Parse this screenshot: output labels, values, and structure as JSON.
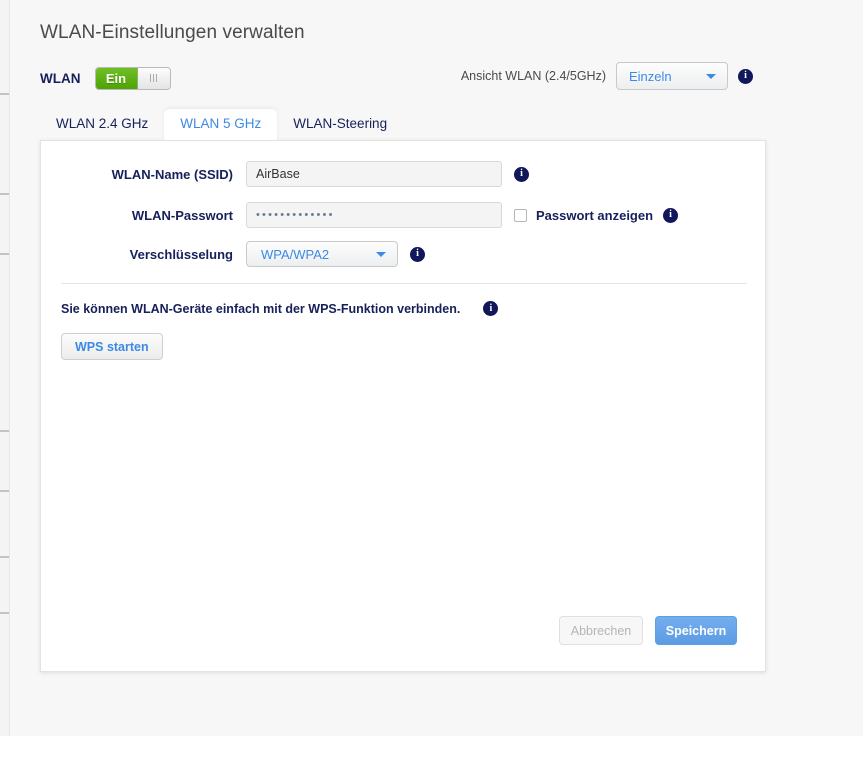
{
  "page": {
    "title": "WLAN-Einstellungen verwalten"
  },
  "header": {
    "wlan_label": "WLAN",
    "toggle_state_label": "Ein",
    "view_label": "Ansicht WLAN (2.4/5GHz)",
    "view_value": "Einzeln",
    "view_options": [
      "Einzeln"
    ],
    "info_icon": "info-icon"
  },
  "tabs": [
    {
      "label": "WLAN 2.4 GHz",
      "active": false
    },
    {
      "label": "WLAN 5 GHz",
      "active": true
    },
    {
      "label": "WLAN-Steering",
      "active": false
    }
  ],
  "form": {
    "ssid": {
      "label": "WLAN-Name (SSID)",
      "value": "AirBase",
      "placeholder": ""
    },
    "password": {
      "label": "WLAN-Passwort",
      "value": "•••••••••••••",
      "placeholder": "",
      "show_password_label": "Passwort anzeigen",
      "show_password_checked": false
    },
    "encryption": {
      "label": "Verschlüsselung",
      "value": "WPA/WPA2",
      "options": [
        "WPA/WPA2"
      ]
    }
  },
  "wps": {
    "description": "Sie können WLAN-Geräte einfach mit der WPS-Funktion verbinden.",
    "button_label": "WPS starten"
  },
  "footer": {
    "cancel_label": "Abbrechen",
    "save_label": "Speichern"
  },
  "colors": {
    "accent_blue": "#3c8ae6",
    "save_blue": "#5c9ce4",
    "toggle_green": "#4ea305",
    "info_navy": "#10175a",
    "label_navy": "#16205a"
  }
}
